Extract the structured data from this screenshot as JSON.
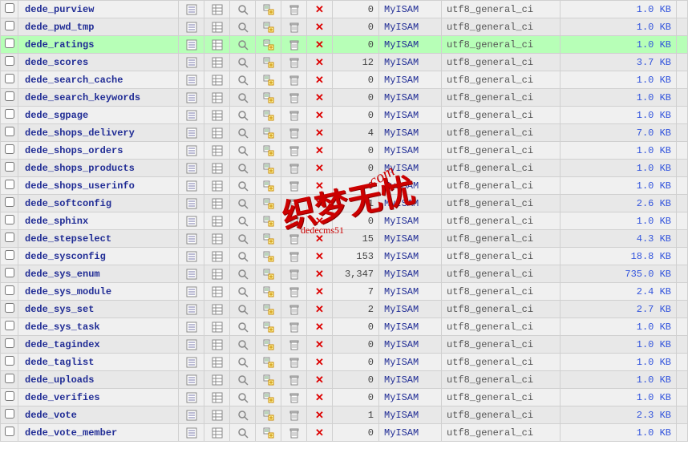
{
  "watermark": {
    "cn": "织梦无忧",
    "com": ".com",
    "url": "dedecms51"
  },
  "rows": [
    {
      "name": "dede_purview",
      "rows": "0",
      "type": "MyISAM",
      "collation": "utf8_general_ci",
      "size": "1.0 KB",
      "hl": false,
      "odd": true
    },
    {
      "name": "dede_pwd_tmp",
      "rows": "0",
      "type": "MyISAM",
      "collation": "utf8_general_ci",
      "size": "1.0 KB",
      "hl": false,
      "odd": false
    },
    {
      "name": "dede_ratings",
      "rows": "0",
      "type": "MyISAM",
      "collation": "utf8_general_ci",
      "size": "1.0 KB",
      "hl": true,
      "odd": true
    },
    {
      "name": "dede_scores",
      "rows": "12",
      "type": "MyISAM",
      "collation": "utf8_general_ci",
      "size": "3.7 KB",
      "hl": false,
      "odd": false
    },
    {
      "name": "dede_search_cache",
      "rows": "0",
      "type": "MyISAM",
      "collation": "utf8_general_ci",
      "size": "1.0 KB",
      "hl": false,
      "odd": true
    },
    {
      "name": "dede_search_keywords",
      "rows": "0",
      "type": "MyISAM",
      "collation": "utf8_general_ci",
      "size": "1.0 KB",
      "hl": false,
      "odd": false
    },
    {
      "name": "dede_sgpage",
      "rows": "0",
      "type": "MyISAM",
      "collation": "utf8_general_ci",
      "size": "1.0 KB",
      "hl": false,
      "odd": true
    },
    {
      "name": "dede_shops_delivery",
      "rows": "4",
      "type": "MyISAM",
      "collation": "utf8_general_ci",
      "size": "7.0 KB",
      "hl": false,
      "odd": false
    },
    {
      "name": "dede_shops_orders",
      "rows": "0",
      "type": "MyISAM",
      "collation": "utf8_general_ci",
      "size": "1.0 KB",
      "hl": false,
      "odd": true
    },
    {
      "name": "dede_shops_products",
      "rows": "0",
      "type": "MyISAM",
      "collation": "utf8_general_ci",
      "size": "1.0 KB",
      "hl": false,
      "odd": false
    },
    {
      "name": "dede_shops_userinfo",
      "rows": "0",
      "type": "MyISAM",
      "collation": "utf8_general_ci",
      "size": "1.0 KB",
      "hl": false,
      "odd": true
    },
    {
      "name": "dede_softconfig",
      "rows": "1",
      "type": "MyISAM",
      "collation": "utf8_general_ci",
      "size": "2.6 KB",
      "hl": false,
      "odd": false
    },
    {
      "name": "dede_sphinx",
      "rows": "0",
      "type": "MyISAM",
      "collation": "utf8_general_ci",
      "size": "1.0 KB",
      "hl": false,
      "odd": true
    },
    {
      "name": "dede_stepselect",
      "rows": "15",
      "type": "MyISAM",
      "collation": "utf8_general_ci",
      "size": "4.3 KB",
      "hl": false,
      "odd": false
    },
    {
      "name": "dede_sysconfig",
      "rows": "153",
      "type": "MyISAM",
      "collation": "utf8_general_ci",
      "size": "18.8 KB",
      "hl": false,
      "odd": true
    },
    {
      "name": "dede_sys_enum",
      "rows": "3,347",
      "type": "MyISAM",
      "collation": "utf8_general_ci",
      "size": "735.0 KB",
      "hl": false,
      "odd": false
    },
    {
      "name": "dede_sys_module",
      "rows": "7",
      "type": "MyISAM",
      "collation": "utf8_general_ci",
      "size": "2.4 KB",
      "hl": false,
      "odd": true
    },
    {
      "name": "dede_sys_set",
      "rows": "2",
      "type": "MyISAM",
      "collation": "utf8_general_ci",
      "size": "2.7 KB",
      "hl": false,
      "odd": false
    },
    {
      "name": "dede_sys_task",
      "rows": "0",
      "type": "MyISAM",
      "collation": "utf8_general_ci",
      "size": "1.0 KB",
      "hl": false,
      "odd": true
    },
    {
      "name": "dede_tagindex",
      "rows": "0",
      "type": "MyISAM",
      "collation": "utf8_general_ci",
      "size": "1.0 KB",
      "hl": false,
      "odd": false
    },
    {
      "name": "dede_taglist",
      "rows": "0",
      "type": "MyISAM",
      "collation": "utf8_general_ci",
      "size": "1.0 KB",
      "hl": false,
      "odd": true
    },
    {
      "name": "dede_uploads",
      "rows": "0",
      "type": "MyISAM",
      "collation": "utf8_general_ci",
      "size": "1.0 KB",
      "hl": false,
      "odd": false
    },
    {
      "name": "dede_verifies",
      "rows": "0",
      "type": "MyISAM",
      "collation": "utf8_general_ci",
      "size": "1.0 KB",
      "hl": false,
      "odd": true
    },
    {
      "name": "dede_vote",
      "rows": "1",
      "type": "MyISAM",
      "collation": "utf8_general_ci",
      "size": "2.3 KB",
      "hl": false,
      "odd": false
    },
    {
      "name": "dede_vote_member",
      "rows": "0",
      "type": "MyISAM",
      "collation": "utf8_general_ci",
      "size": "1.0 KB",
      "hl": false,
      "odd": true
    }
  ]
}
